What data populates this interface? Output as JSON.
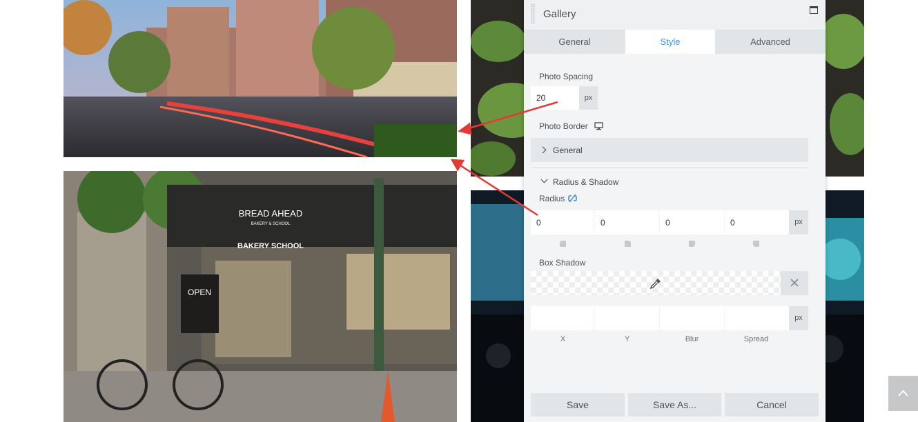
{
  "panel": {
    "title": "Gallery",
    "tabs": [
      {
        "label": "General",
        "active": false
      },
      {
        "label": "Style",
        "active": true
      },
      {
        "label": "Advanced",
        "active": false
      }
    ]
  },
  "photo_spacing": {
    "label": "Photo Spacing",
    "value": "20",
    "unit": "px"
  },
  "photo_border": {
    "label": "Photo Border",
    "general_label": "General",
    "radius_shadow_label": "Radius & Shadow",
    "radius": {
      "label": "Radius",
      "values": [
        "0",
        "0",
        "0",
        "0"
      ],
      "unit": "px"
    }
  },
  "box_shadow": {
    "label": "Box Shadow",
    "values": [
      "",
      "",
      "",
      ""
    ],
    "unit": "px",
    "field_labels": [
      "X",
      "Y",
      "Blur",
      "Spread"
    ]
  },
  "buttons": {
    "save": "Save",
    "save_as": "Save As...",
    "cancel": "Cancel"
  },
  "photos": {
    "storefront_sign": "BREAD AHEAD",
    "storefront_sub": "BAKERY & SCHOOL",
    "awning_text": "BAKERY SCHOOL",
    "board_text": "OPEN"
  },
  "colors": {
    "accent": "#3b8fd6",
    "annotation_arrow": "#e53935"
  }
}
